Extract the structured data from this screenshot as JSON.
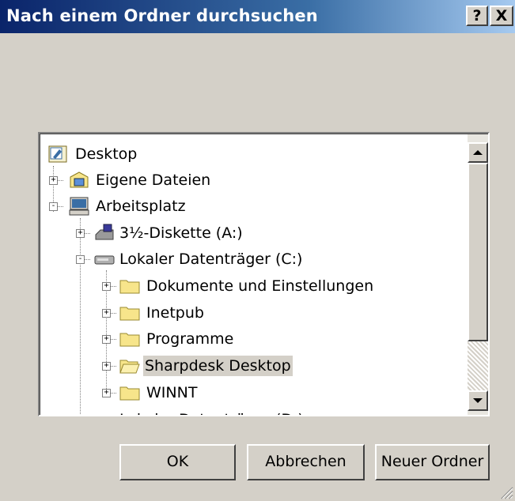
{
  "window": {
    "title": "Nach einem Ordner durchsuchen",
    "help_label": "?",
    "close_label": "X"
  },
  "tree": {
    "items": [
      {
        "label": "Desktop",
        "icon": "desktop-icon",
        "expander": "",
        "level": 0
      },
      {
        "label": "Eigene Dateien",
        "icon": "my-documents-icon",
        "expander": "+",
        "level": 1
      },
      {
        "label": "Arbeitsplatz",
        "icon": "my-computer-icon",
        "expander": "-",
        "level": 1
      },
      {
        "label": "3½-Diskette (A:)",
        "icon": "floppy-drive-icon",
        "expander": "+",
        "level": 2
      },
      {
        "label": "Lokaler Datenträger (C:)",
        "icon": "hard-drive-icon",
        "expander": "-",
        "level": 2
      },
      {
        "label": "Dokumente und Einstellungen",
        "icon": "folder-icon",
        "expander": "+",
        "level": 3
      },
      {
        "label": "Inetpub",
        "icon": "folder-icon",
        "expander": "+",
        "level": 3
      },
      {
        "label": "Programme",
        "icon": "folder-icon",
        "expander": "+",
        "level": 3
      },
      {
        "label": "Sharpdesk Desktop",
        "icon": "folder-open-icon",
        "expander": "+",
        "level": 3,
        "selected": true
      },
      {
        "label": "WINNT",
        "icon": "folder-icon",
        "expander": "+",
        "level": 3
      }
    ],
    "partial_item": "Lokaler Datenträger (D:)"
  },
  "buttons": {
    "ok": "OK",
    "cancel": "Abbrechen",
    "new_folder": "Neuer Ordner"
  },
  "colors": {
    "title_start": "#0a246a",
    "title_end": "#a6caf0",
    "face": "#d4d0c8",
    "folder": "#f7e58b"
  }
}
